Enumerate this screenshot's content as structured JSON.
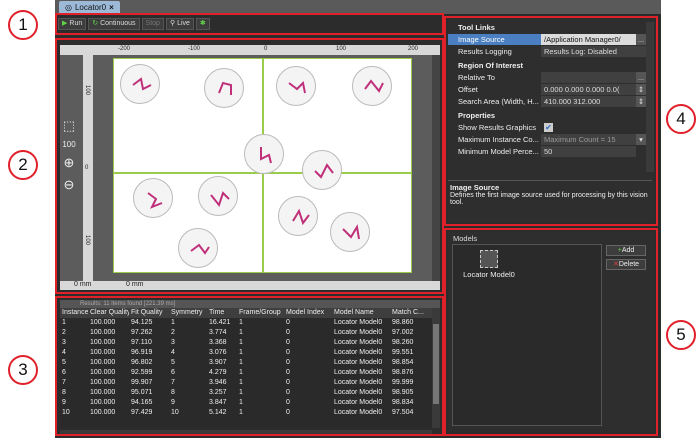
{
  "tab": {
    "title": "Locator0",
    "close": "×"
  },
  "callouts": [
    "1",
    "2",
    "3",
    "4",
    "5"
  ],
  "toolbar": {
    "run": "Run",
    "continuous": "Continuous",
    "stop": "Stop",
    "live": "Live"
  },
  "image": {
    "ruler_top": [
      "-200",
      "-100",
      "0",
      "100",
      "200"
    ],
    "ruler_left": [
      "100",
      "0",
      "100"
    ],
    "ruler_bottom": [
      "0 mm",
      "0 mm"
    ],
    "zoom_label": "100"
  },
  "results": {
    "header": "Results: 11 items found [221.39 ms]",
    "columns": [
      "Instance",
      "Clear Quality",
      "Fit Quality",
      "Symmetry",
      "Time",
      "Frame/Group",
      "Model Index",
      "Model Name",
      "Match C..."
    ],
    "rows": [
      [
        "1",
        "100.000",
        "94.125",
        "1",
        "16.421",
        "1",
        "0",
        "Locator Model0",
        "98.860"
      ],
      [
        "2",
        "100.000",
        "97.262",
        "2",
        "3.774",
        "1",
        "0",
        "Locator Model0",
        "97.002"
      ],
      [
        "3",
        "100.000",
        "97.110",
        "3",
        "3.368",
        "1",
        "0",
        "Locator Model0",
        "98.260"
      ],
      [
        "4",
        "100.000",
        "96.919",
        "4",
        "3.076",
        "1",
        "0",
        "Locator Model0",
        "99.551"
      ],
      [
        "5",
        "100.000",
        "96.802",
        "5",
        "3.907",
        "1",
        "0",
        "Locator Model0",
        "98.854"
      ],
      [
        "6",
        "100.000",
        "92.599",
        "6",
        "4.279",
        "1",
        "0",
        "Locator Model0",
        "98.876"
      ],
      [
        "7",
        "100.000",
        "99.907",
        "7",
        "3.946",
        "1",
        "0",
        "Locator Model0",
        "99.999"
      ],
      [
        "8",
        "100.000",
        "95.071",
        "8",
        "3.257",
        "1",
        "0",
        "Locator Model0",
        "98.905"
      ],
      [
        "9",
        "100.000",
        "94.165",
        "9",
        "3.847",
        "1",
        "0",
        "Locator Model0",
        "98.834"
      ],
      [
        "10",
        "100.000",
        "97.429",
        "10",
        "5.142",
        "1",
        "0",
        "Locator Model0",
        "97.504"
      ]
    ]
  },
  "properties": {
    "cat_tool_links": "Tool Links",
    "image_source_label": "Image Source",
    "image_source_value": "/Application Manager0/",
    "results_logging_label": "Results Logging",
    "results_logging_value": "Results Log: Disabled",
    "cat_roi": "Region Of Interest",
    "relative_to_label": "Relative To",
    "relative_to_value": "",
    "offset_label": "Offset",
    "offset_value": "0.000 0.000 0.000 0.0(",
    "search_area_label": "Search Area (Width, H...",
    "search_area_value": "410.000 312.000",
    "cat_properties": "Properties",
    "show_graphics_label": "Show Results Graphics",
    "max_instance_label": "Maximum Instance Co...",
    "max_instance_value": "Maximum Count = 15",
    "min_model_label": "Minimum Model Perce...",
    "min_model_value": "50",
    "button_dots": "...",
    "desc_title": "Image Source",
    "desc_text": "Defines the first image source used for processing by this vision tool."
  },
  "models": {
    "label": "Models",
    "item": "Locator Model0",
    "add": "Add",
    "delete": "Delete"
  },
  "colors": {
    "highlight_red": "#e0212a",
    "selection_blue": "#4a7fc1",
    "match_green": "#9acb4a",
    "path_magenta": "#c0307a"
  }
}
